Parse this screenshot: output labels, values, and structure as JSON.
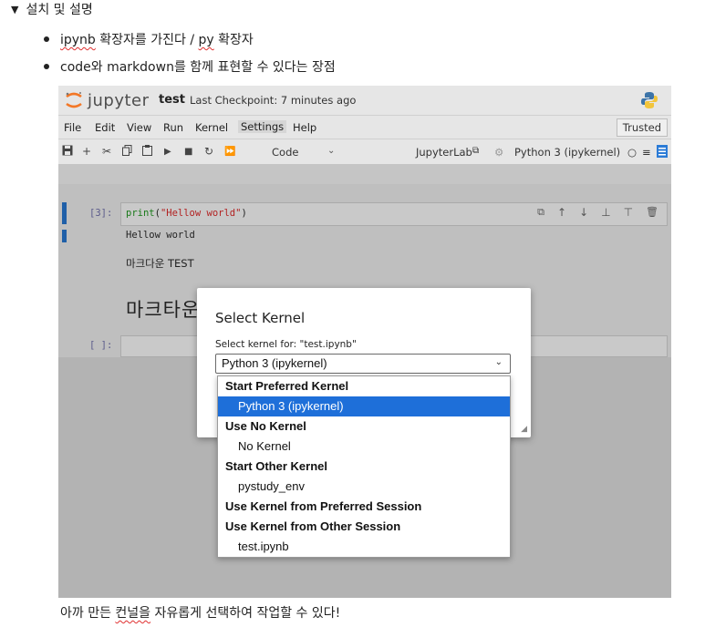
{
  "doc": {
    "heading_marker": "▼",
    "heading": "설치 및 설명",
    "bullet1_a": "ipynb",
    "bullet1_b": " 확장자를 가진다  / ",
    "bullet1_c": "py",
    "bullet1_d": " 확장자",
    "bullet2": "code와 markdown를 함께 표현할 수 있다는 장점",
    "bottom_a": "아까 만든 ",
    "bottom_b": "컨널을",
    "bottom_c": " 자유롭게 선택하여 작업할 수 있다!"
  },
  "jupyter": {
    "logo_text": "jupyter",
    "notebook_name": "test",
    "checkpoint": "Last Checkpoint: 7 minutes ago",
    "menu": [
      "File",
      "Edit",
      "View",
      "Run",
      "Kernel",
      "Settings",
      "Help"
    ],
    "trusted": "Trusted",
    "toolbar": {
      "cell_type": "Code",
      "jupyterlab": "JupyterLab",
      "kernel": "Python 3 (ipykernel)"
    },
    "cells": {
      "prompt1": "[3]:",
      "code_func": "print",
      "code_open": "(",
      "code_str": "\"Hellow world\"",
      "code_close": ")",
      "output": "Hellow world",
      "md1": "마크다운 TEST",
      "md2": "마크타운",
      "prompt2": "[ ]:"
    }
  },
  "dialog": {
    "title": "Select Kernel",
    "label": "Select kernel for: \"test.ipynb\"",
    "selected_value": "Python 3 (ipykernel)"
  },
  "dropdown": {
    "g1": "Start Preferred Kernel",
    "o1": "Python 3 (ipykernel)",
    "g2": "Use No Kernel",
    "o2": "No Kernel",
    "g3": "Start Other Kernel",
    "o3": "pystudy_env",
    "g4": "Use Kernel from Preferred Session",
    "g5": "Use Kernel from Other Session",
    "o4": "test.ipynb"
  },
  "colors": {
    "selected_bg": "#1e6fd9",
    "cell_bar": "#1f5fa8",
    "string": "#b22222",
    "keyword": "#1a7a1a"
  }
}
